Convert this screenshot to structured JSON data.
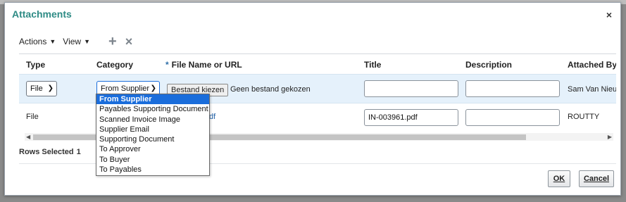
{
  "dialog": {
    "title": "Attachments",
    "close_glyph": "×"
  },
  "toolbar": {
    "actions_label": "Actions",
    "view_label": "View",
    "add_glyph": "+",
    "delete_glyph": "×",
    "add_icon": "plus-icon",
    "delete_icon": "x-icon"
  },
  "table": {
    "columns": {
      "type": "Type",
      "category": "Category",
      "required_marker": "*",
      "file_name": "File Name or URL",
      "title": "Title",
      "description": "Description",
      "attached_by": "Attached By"
    },
    "rows": [
      {
        "type": "File",
        "category": "From Supplier",
        "file_button": "Bestand kiezen",
        "file_status": "Geen bestand gekozen",
        "title": "",
        "description": "",
        "attached_by": "Sam Van Nieu"
      },
      {
        "type": "File",
        "file_link_partial": "df",
        "title": "IN-003961.pdf",
        "description": "",
        "attached_by": "ROUTTY"
      }
    ]
  },
  "category_dropdown": {
    "selected": "From Supplier",
    "options": [
      "From Supplier",
      "Payables Supporting Document",
      "Scanned Invoice Image",
      "Supplier Email",
      "Supporting Document",
      "To Approver",
      "To Buyer",
      "To Payables"
    ]
  },
  "status": {
    "rows_selected_label": "Rows Selected",
    "rows_selected_count": "1"
  },
  "buttons": {
    "ok": "OK",
    "cancel": "Cancel"
  },
  "colors": {
    "title": "#2e8b85",
    "selected_row": "#e5f1fb",
    "dropdown_highlight": "#1a6ddb"
  }
}
